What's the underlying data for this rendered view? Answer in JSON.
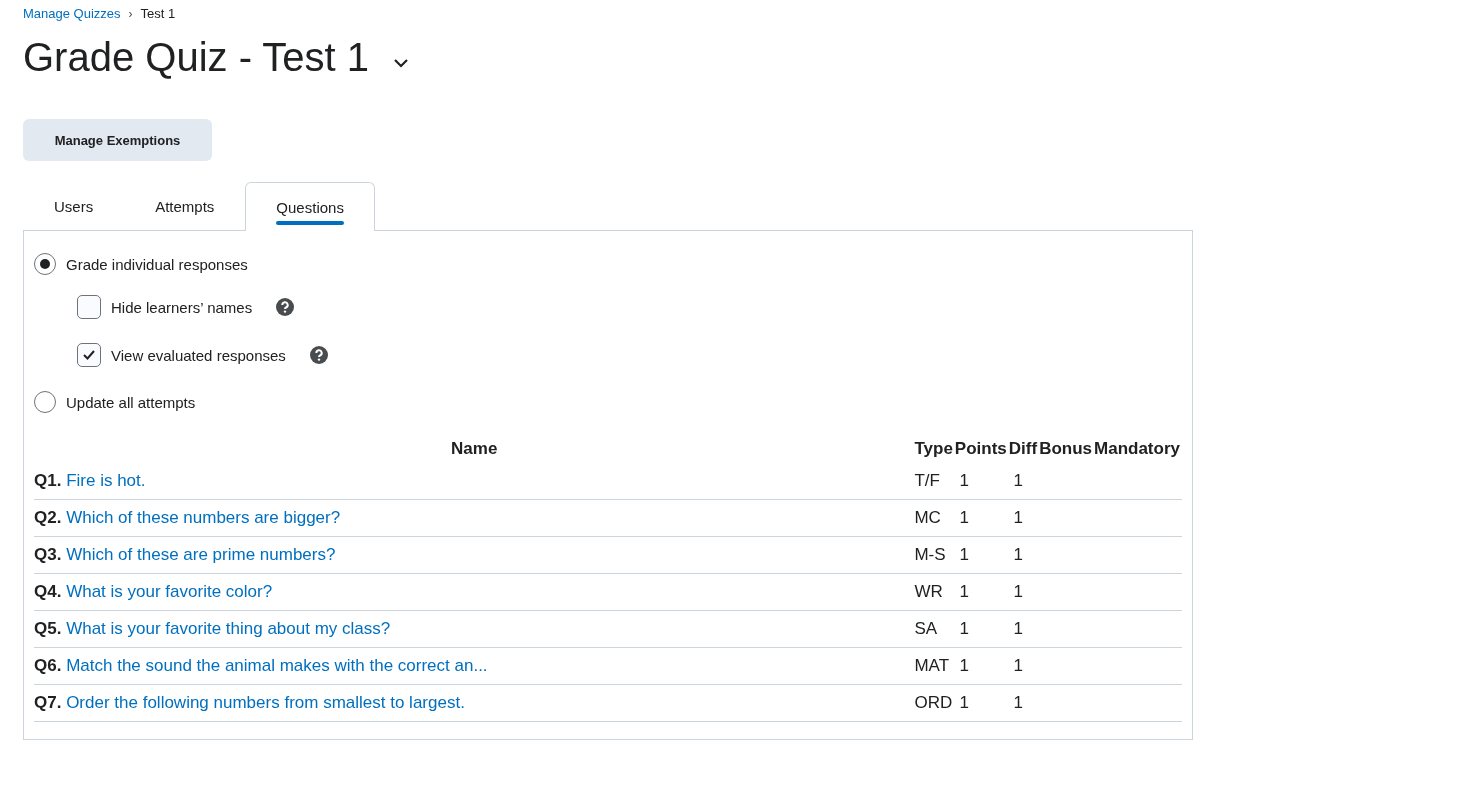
{
  "breadcrumb": {
    "link": "Manage Quizzes",
    "separator": "›",
    "current": "Test 1"
  },
  "title": "Grade Quiz - Test 1",
  "manage_button": "Manage Exemptions",
  "tabs": [
    {
      "label": "Users",
      "selected": false
    },
    {
      "label": "Attempts",
      "selected": false
    },
    {
      "label": "Questions",
      "selected": true
    }
  ],
  "grade_options": [
    {
      "label": "Grade individual responses",
      "selected": true,
      "options": [
        {
          "label": "Hide learners’ names",
          "checked": false
        },
        {
          "label": "View evaluated responses",
          "checked": true
        }
      ]
    },
    {
      "label": "Update all attempts",
      "selected": false
    }
  ],
  "table": {
    "columns": [
      "Name",
      "Type",
      "Points",
      "Diff",
      "Bonus",
      "Mandatory"
    ],
    "rows": [
      {
        "number": "Q1.",
        "name": "Fire is hot.",
        "type": "T/F",
        "points": "1",
        "diff": "1"
      },
      {
        "number": "Q2.",
        "name": "Which of these numbers are bigger?",
        "type": "MC",
        "points": "1",
        "diff": "1"
      },
      {
        "number": "Q3.",
        "name": "Which of these are prime numbers?",
        "type": "M-S",
        "points": "1",
        "diff": "1"
      },
      {
        "number": "Q4.",
        "name": "What is your favorite color?",
        "type": "WR",
        "points": "1",
        "diff": "1"
      },
      {
        "number": "Q5.",
        "name": "What is your favorite thing about my class?",
        "type": "SA",
        "points": "1",
        "diff": "1"
      },
      {
        "number": "Q6.",
        "name": "Match the sound the animal makes with the correct an...",
        "type": "MAT",
        "points": "1",
        "diff": "1"
      },
      {
        "number": "Q7.",
        "name": "Order the following numbers from smallest to largest.",
        "type": "ORD",
        "points": "1",
        "diff": "1"
      }
    ]
  }
}
